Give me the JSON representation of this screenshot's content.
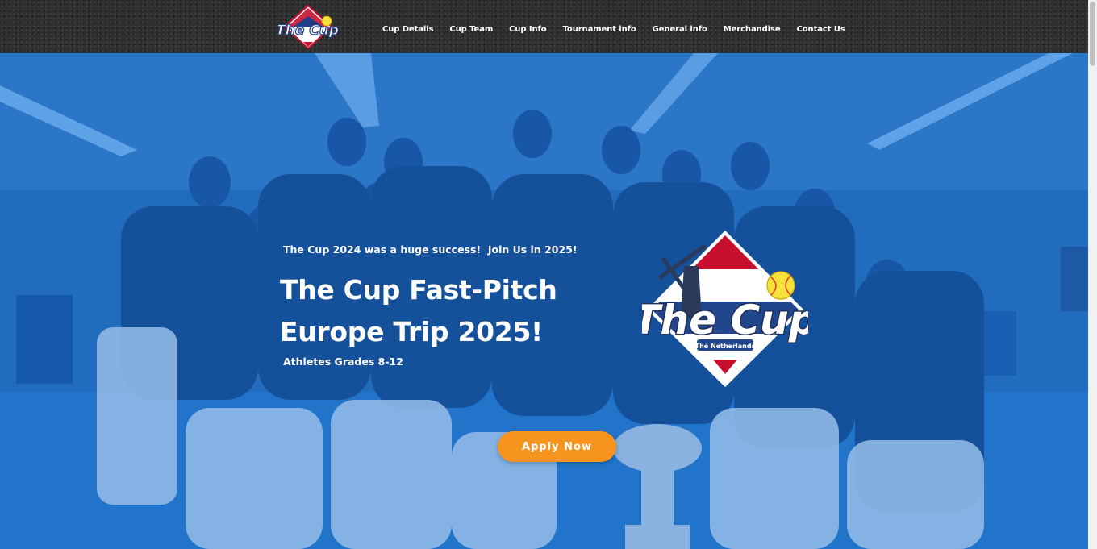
{
  "header": {
    "logo": {
      "title": "The Cup",
      "icon": "the-cup-logo"
    },
    "nav": [
      {
        "label": "Cup Details"
      },
      {
        "label": "Cup Team"
      },
      {
        "label": "Cup Info"
      },
      {
        "label": "Tournament info"
      },
      {
        "label": "General info"
      },
      {
        "label": "Merchandise"
      },
      {
        "label": "Contact Us"
      }
    ]
  },
  "hero": {
    "kicker": "The Cup 2024 was a huge success!  Join Us in 2025!",
    "headline_line1": "The Cup Fast-Pitch",
    "headline_line2": "Europe Trip 2025!",
    "subline": "Athletes Grades 8-12",
    "apply_label": "Apply Now",
    "logo": {
      "title": "The Cup",
      "subtitle": "The Netherlands",
      "icon": "windmill-flag-softball-logo"
    }
  },
  "colors": {
    "accent": "#f7941d",
    "hero_tint": "#1b6ed2",
    "header_bg": "#2a2a2a"
  }
}
